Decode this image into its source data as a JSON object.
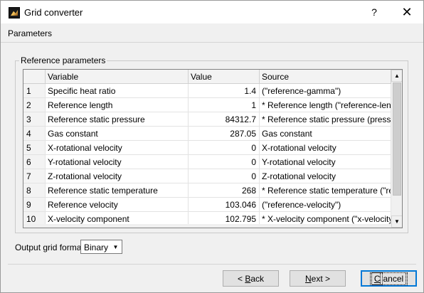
{
  "window": {
    "title": "Grid converter",
    "help_label": "?",
    "close_label": "✕"
  },
  "params_bar": {
    "label": "Parameters"
  },
  "group": {
    "legend": "Reference parameters"
  },
  "table": {
    "columns": [
      "",
      "Variable",
      "Value",
      "Source"
    ],
    "rows": [
      {
        "num": "1",
        "variable": "Specific heat ratio",
        "value": "1.4",
        "source": "(\"reference-gamma\")"
      },
      {
        "num": "2",
        "variable": "Reference length",
        "value": "1",
        "source": "* Reference length (\"reference-length\""
      },
      {
        "num": "3",
        "variable": "Reference static pressure",
        "value": "84312.7",
        "source": "* Reference static pressure (pressure-fa"
      },
      {
        "num": "4",
        "variable": "Gas constant",
        "value": "287.05",
        "source": "Gas constant"
      },
      {
        "num": "5",
        "variable": "X-rotational velocity",
        "value": "0",
        "source": "X-rotational velocity"
      },
      {
        "num": "6",
        "variable": "Y-rotational velocity",
        "value": "0",
        "source": "Y-rotational velocity"
      },
      {
        "num": "7",
        "variable": "Z-rotational velocity",
        "value": "0",
        "source": "Z-rotational velocity"
      },
      {
        "num": "8",
        "variable": "Reference static temperature",
        "value": "268",
        "source": "* Reference static temperature (\"refere"
      },
      {
        "num": "9",
        "variable": "Reference velocity",
        "value": "103.046",
        "source": "(\"reference-velocity\")"
      },
      {
        "num": "10",
        "variable": "X-velocity component",
        "value": "102.795",
        "source": "* X-velocity component (\"x-velocity/de"
      }
    ]
  },
  "output_format": {
    "label": "Output grid format",
    "selected": "Binary"
  },
  "buttons": {
    "back_prefix": "< ",
    "back_accel": "B",
    "back_rest": "ack",
    "next_accel": "N",
    "next_rest": "ext >",
    "cancel_accel": "C",
    "cancel_rest": "ancel"
  },
  "icons": {
    "app": "app-logo-icon",
    "scroll_up": "chevron-up-icon",
    "scroll_down": "chevron-down-icon",
    "dropdown": "chevron-down-icon"
  }
}
